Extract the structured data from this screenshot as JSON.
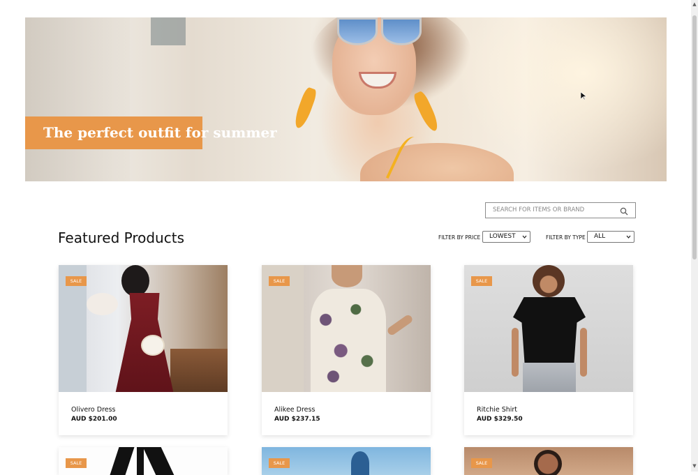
{
  "hero": {
    "title": "The perfect outfit for summer"
  },
  "search": {
    "placeholder": "SEARCH FOR ITEMS OR BRAND"
  },
  "section": {
    "title": "Featured Products"
  },
  "filters": {
    "price_label": "FILTER BY PRICE",
    "price_value": "LOWEST",
    "type_label": "FILTER BY TYPE",
    "type_value": "ALL"
  },
  "products": [
    {
      "badge": "SALE",
      "name": "Olivero Dress",
      "price": "AUD $201.00"
    },
    {
      "badge": "SALE",
      "name": "Alikee Dress",
      "price": "AUD $237.15"
    },
    {
      "badge": "SALE",
      "name": "Ritchie Shirt",
      "price": "AUD $329.50"
    },
    {
      "badge": "SALE"
    },
    {
      "badge": "SALE"
    },
    {
      "badge": "SALE"
    }
  ],
  "colors": {
    "accent": "#e8974a"
  },
  "icons": {
    "search": "search-icon",
    "dropdown": "chevron-down-icon"
  }
}
